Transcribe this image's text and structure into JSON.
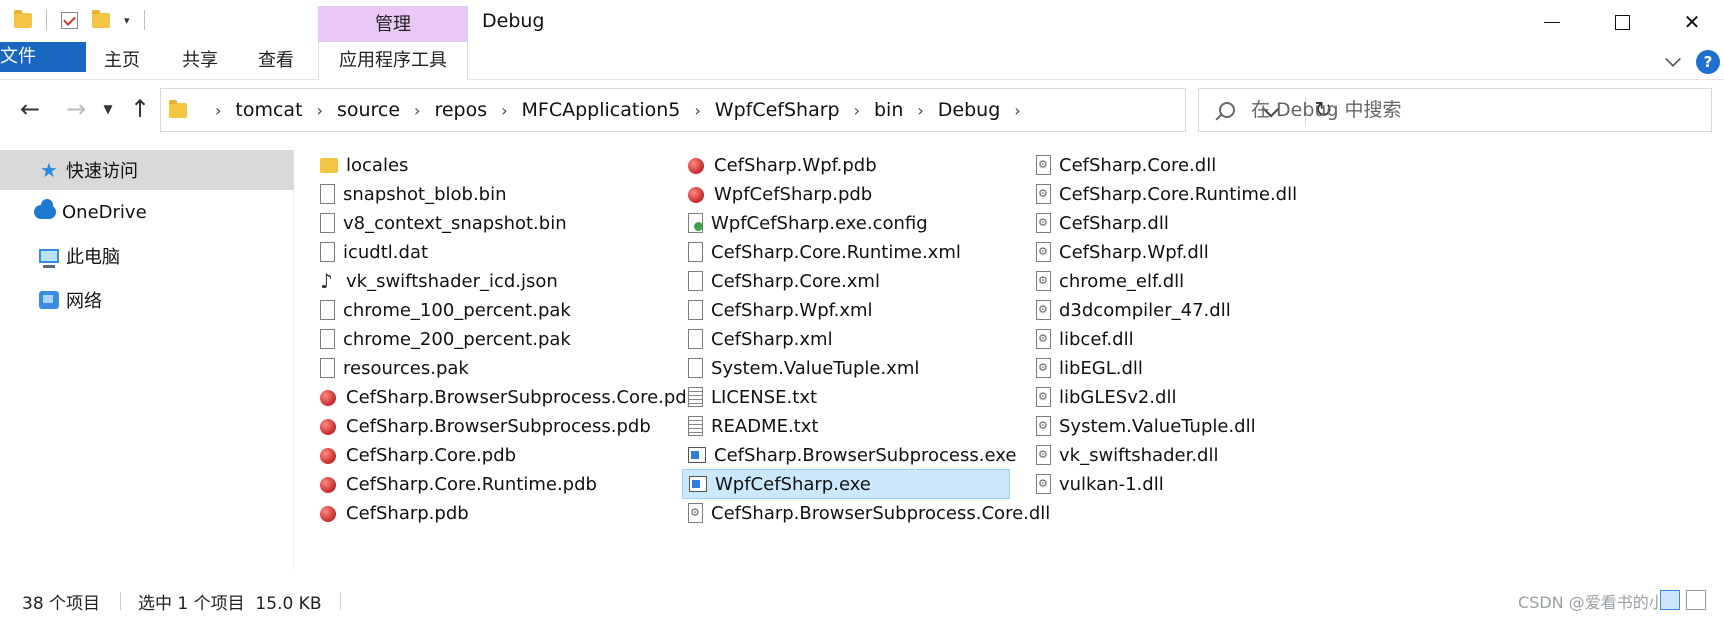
{
  "window": {
    "title": "Debug",
    "manage_tab": "管理"
  },
  "ribbon": {
    "tabs": [
      "文件",
      "主页",
      "共享",
      "查看",
      "应用程序工具"
    ]
  },
  "address": {
    "crumbs": [
      "tomcat",
      "source",
      "repos",
      "MFCApplication5",
      "WpfCefSharp",
      "bin",
      "Debug"
    ]
  },
  "search": {
    "placeholder": "在 Debug 中搜索"
  },
  "sidebar": {
    "items": [
      "快速访问",
      "OneDrive",
      "此电脑",
      "网络"
    ]
  },
  "files": {
    "col1": [
      {
        "name": "locales",
        "icon": "folder"
      },
      {
        "name": "snapshot_blob.bin",
        "icon": "blank"
      },
      {
        "name": "v8_context_snapshot.bin",
        "icon": "blank"
      },
      {
        "name": "icudtl.dat",
        "icon": "blank"
      },
      {
        "name": "vk_swiftshader_icd.json",
        "icon": "json"
      },
      {
        "name": "chrome_100_percent.pak",
        "icon": "blank"
      },
      {
        "name": "chrome_200_percent.pak",
        "icon": "blank"
      },
      {
        "name": "resources.pak",
        "icon": "blank"
      },
      {
        "name": "CefSharp.BrowserSubprocess.Core.pdb",
        "icon": "pdb"
      },
      {
        "name": "CefSharp.BrowserSubprocess.pdb",
        "icon": "pdb"
      },
      {
        "name": "CefSharp.Core.pdb",
        "icon": "pdb"
      },
      {
        "name": "CefSharp.Core.Runtime.pdb",
        "icon": "pdb"
      },
      {
        "name": "CefSharp.pdb",
        "icon": "pdb"
      }
    ],
    "col2": [
      {
        "name": "CefSharp.Wpf.pdb",
        "icon": "pdb"
      },
      {
        "name": "WpfCefSharp.pdb",
        "icon": "pdb"
      },
      {
        "name": "WpfCefSharp.exe.config",
        "icon": "config"
      },
      {
        "name": "CefSharp.Core.Runtime.xml",
        "icon": "blank"
      },
      {
        "name": "CefSharp.Core.xml",
        "icon": "blank"
      },
      {
        "name": "CefSharp.Wpf.xml",
        "icon": "blank"
      },
      {
        "name": "CefSharp.xml",
        "icon": "blank"
      },
      {
        "name": "System.ValueTuple.xml",
        "icon": "blank"
      },
      {
        "name": "LICENSE.txt",
        "icon": "txt"
      },
      {
        "name": "README.txt",
        "icon": "txt"
      },
      {
        "name": "CefSharp.BrowserSubprocess.exe",
        "icon": "exe"
      },
      {
        "name": "WpfCefSharp.exe",
        "icon": "exe",
        "selected": true
      },
      {
        "name": "CefSharp.BrowserSubprocess.Core.dll",
        "icon": "dll"
      }
    ],
    "col3": [
      {
        "name": "CefSharp.Core.dll",
        "icon": "dll"
      },
      {
        "name": "CefSharp.Core.Runtime.dll",
        "icon": "dll"
      },
      {
        "name": "CefSharp.dll",
        "icon": "dll"
      },
      {
        "name": "CefSharp.Wpf.dll",
        "icon": "dll"
      },
      {
        "name": "chrome_elf.dll",
        "icon": "dll"
      },
      {
        "name": "d3dcompiler_47.dll",
        "icon": "dll"
      },
      {
        "name": "libcef.dll",
        "icon": "dll"
      },
      {
        "name": "libEGL.dll",
        "icon": "dll"
      },
      {
        "name": "libGLESv2.dll",
        "icon": "dll"
      },
      {
        "name": "System.ValueTuple.dll",
        "icon": "dll"
      },
      {
        "name": "vk_swiftshader.dll",
        "icon": "dll"
      },
      {
        "name": "vulkan-1.dll",
        "icon": "dll"
      }
    ]
  },
  "status": {
    "count": "38 个项目",
    "selection": "选中 1 个项目  15.0 KB",
    "watermark": "CSDN @爱看书的小沐"
  },
  "colors": {
    "file_tab": "#1967c0",
    "manage_tab": "#e8c9f5",
    "selection": "#cce8ff",
    "sidebar_active": "#d9d9d9"
  }
}
